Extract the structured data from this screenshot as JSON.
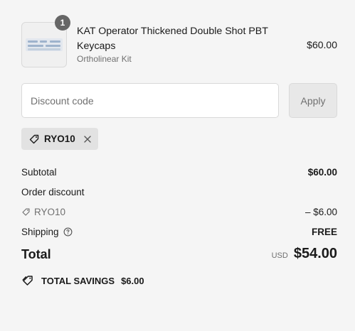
{
  "line_item": {
    "quantity": "1",
    "title": "KAT Operator Thickened Double Shot PBT Keycaps",
    "variant": "Ortholinear Kit",
    "price": "$60.00"
  },
  "discount": {
    "placeholder": "Discount code",
    "apply_label": "Apply",
    "applied_code": "RYO10"
  },
  "summary": {
    "subtotal_label": "Subtotal",
    "subtotal_value": "$60.00",
    "order_discount_label": "Order discount",
    "discount_code": "RYO10",
    "discount_value": "– $6.00",
    "shipping_label": "Shipping",
    "shipping_value": "FREE",
    "total_label": "Total",
    "currency": "USD",
    "total_value": "$54.00",
    "savings_label": "TOTAL SAVINGS",
    "savings_value": "$6.00"
  },
  "icons": {
    "tag": "tag-icon",
    "close": "close-icon",
    "info": "info-icon",
    "savings": "savings-tag-icon"
  },
  "colors": {
    "background": "#f5f5f5",
    "muted_text": "#707070",
    "badge": "#666666",
    "tag_bg": "#e2e2e2"
  }
}
